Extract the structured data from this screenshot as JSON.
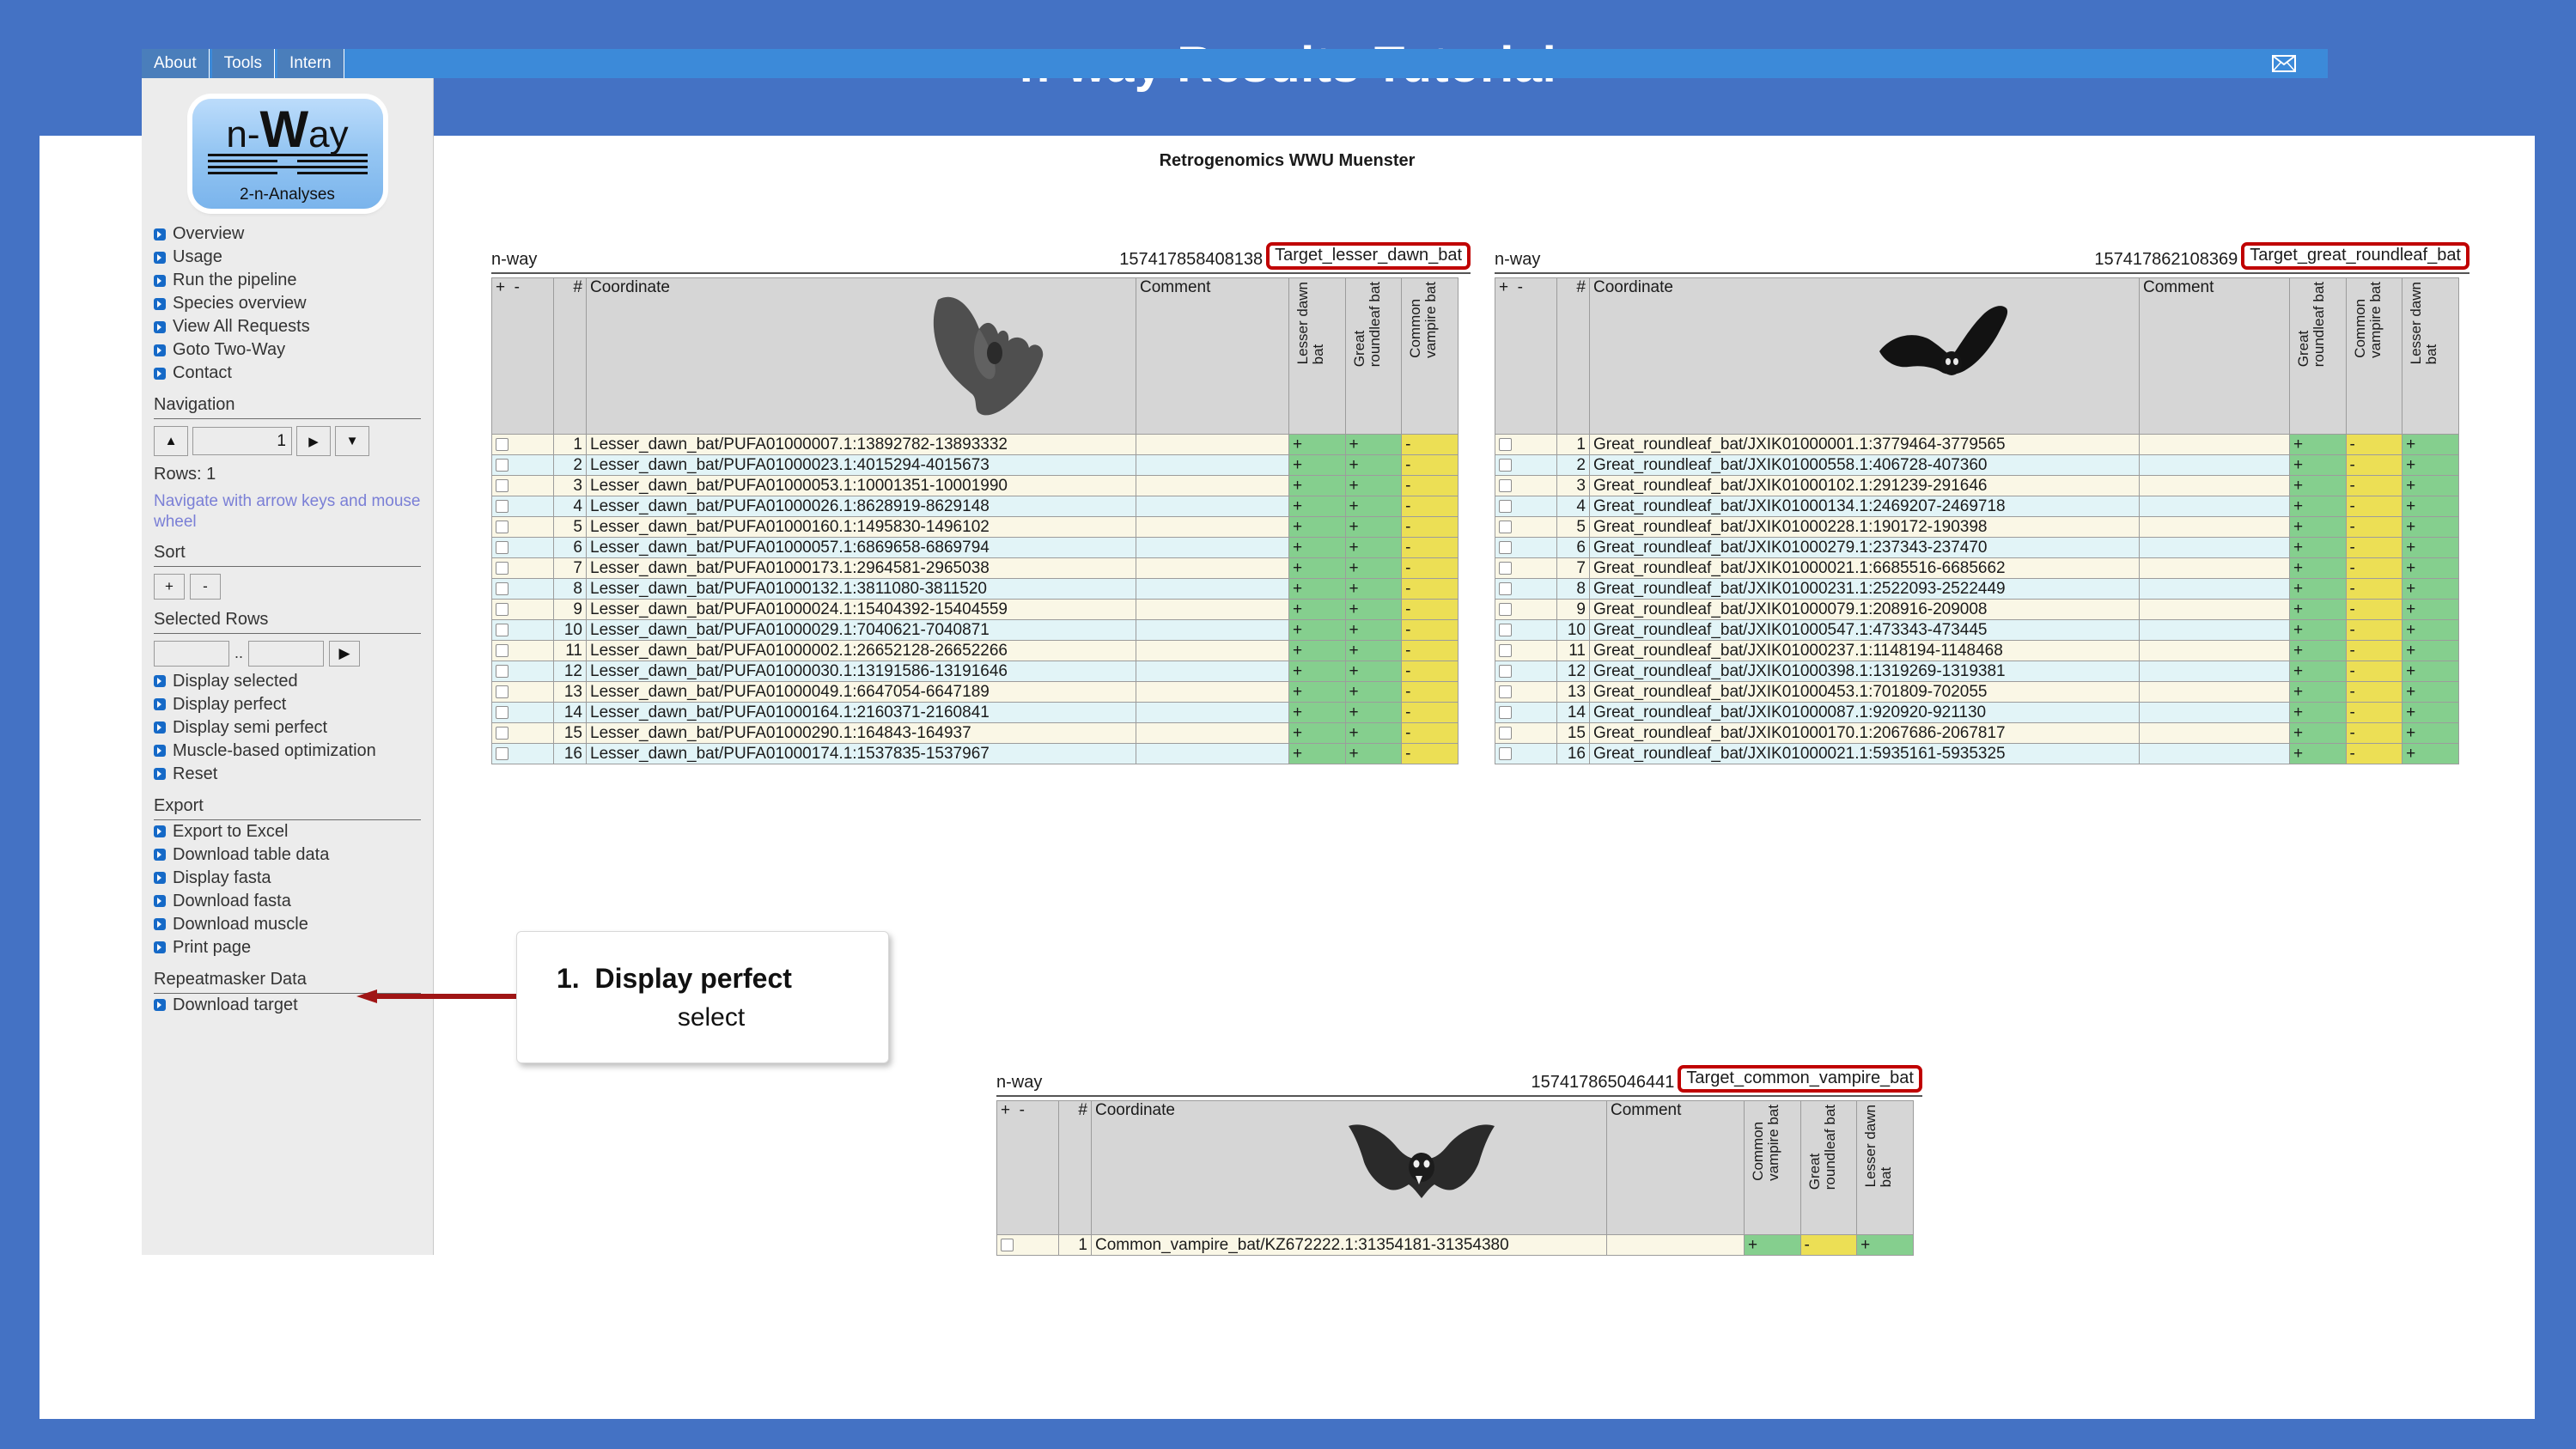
{
  "slide": {
    "title": "n-way Results Tutorial",
    "accent_color": "#4472c4"
  },
  "page_header": "Retrogenomics WWU Muenster",
  "navbar": {
    "items": [
      "About",
      "Tools",
      "Intern"
    ],
    "mail_icon": "envelope-icon"
  },
  "sidebar": {
    "logo": {
      "line1_prefix": "n-",
      "line1_big": "W",
      "line1_suffix": "ay",
      "caption": "2-n-Analyses"
    },
    "main_links": [
      "Overview",
      "Usage",
      "Run the pipeline",
      "Species overview",
      "View All Requests",
      "Goto Two-Way",
      "Contact"
    ],
    "navigation": {
      "heading": "Navigation",
      "up_label": "▲",
      "page_value": "1",
      "go_label": "▶",
      "down_label": "▼",
      "rows_label": "Rows: 1",
      "hint": "Navigate with arrow keys and mouse wheel"
    },
    "sort": {
      "heading": "Sort",
      "plus_label": "+",
      "minus_label": "-"
    },
    "selected_rows": {
      "heading": "Selected Rows",
      "from_value": "",
      "separator": "..",
      "to_value": "",
      "go_label": "▶",
      "links": [
        "Display selected",
        "Display perfect",
        "Display semi perfect",
        "Muscle-based optimization",
        "Reset"
      ]
    },
    "export": {
      "heading": "Export",
      "links": [
        "Export to Excel",
        "Download table data",
        "Display fasta",
        "Download fasta",
        "Download muscle",
        "Print page"
      ]
    },
    "repeatmasker": {
      "heading": "Repeatmasker Data",
      "links": [
        "Download target"
      ]
    }
  },
  "callout": {
    "step": "1.",
    "title": "Display perfect",
    "subtitle": "select",
    "arrow_color": "#a01515"
  },
  "tables": [
    {
      "caption_left": "n-way",
      "id": "157417858408138",
      "target": "Target_lesser_dawn_bat",
      "bat_icon": "fruit-bat-silhouette",
      "columns": {
        "plus": "+",
        "minus": "-",
        "hash": "#",
        "coordinate": "Coordinate",
        "comment": "Comment",
        "species": [
          "Lesser dawn\nbat",
          "Great\nroundleaf bat",
          "Common\nvampire bat"
        ]
      },
      "rows": [
        {
          "n": "1",
          "coord": "Lesser_dawn_bat/PUFA01000007.1:13892782-13893332",
          "comment": "",
          "marks": [
            "+",
            "+",
            "-"
          ]
        },
        {
          "n": "2",
          "coord": "Lesser_dawn_bat/PUFA01000023.1:4015294-4015673",
          "comment": "",
          "marks": [
            "+",
            "+",
            "-"
          ]
        },
        {
          "n": "3",
          "coord": "Lesser_dawn_bat/PUFA01000053.1:10001351-10001990",
          "comment": "",
          "marks": [
            "+",
            "+",
            "-"
          ]
        },
        {
          "n": "4",
          "coord": "Lesser_dawn_bat/PUFA01000026.1:8628919-8629148",
          "comment": "",
          "marks": [
            "+",
            "+",
            "-"
          ]
        },
        {
          "n": "5",
          "coord": "Lesser_dawn_bat/PUFA01000160.1:1495830-1496102",
          "comment": "",
          "marks": [
            "+",
            "+",
            "-"
          ]
        },
        {
          "n": "6",
          "coord": "Lesser_dawn_bat/PUFA01000057.1:6869658-6869794",
          "comment": "",
          "marks": [
            "+",
            "+",
            "-"
          ]
        },
        {
          "n": "7",
          "coord": "Lesser_dawn_bat/PUFA01000173.1:2964581-2965038",
          "comment": "",
          "marks": [
            "+",
            "+",
            "-"
          ]
        },
        {
          "n": "8",
          "coord": "Lesser_dawn_bat/PUFA01000132.1:3811080-3811520",
          "comment": "",
          "marks": [
            "+",
            "+",
            "-"
          ]
        },
        {
          "n": "9",
          "coord": "Lesser_dawn_bat/PUFA01000024.1:15404392-15404559",
          "comment": "",
          "marks": [
            "+",
            "+",
            "-"
          ]
        },
        {
          "n": "10",
          "coord": "Lesser_dawn_bat/PUFA01000029.1:7040621-7040871",
          "comment": "",
          "marks": [
            "+",
            "+",
            "-"
          ]
        },
        {
          "n": "11",
          "coord": "Lesser_dawn_bat/PUFA01000002.1:26652128-26652266",
          "comment": "",
          "marks": [
            "+",
            "+",
            "-"
          ]
        },
        {
          "n": "12",
          "coord": "Lesser_dawn_bat/PUFA01000030.1:13191586-13191646",
          "comment": "",
          "marks": [
            "+",
            "+",
            "-"
          ]
        },
        {
          "n": "13",
          "coord": "Lesser_dawn_bat/PUFA01000049.1:6647054-6647189",
          "comment": "",
          "marks": [
            "+",
            "+",
            "-"
          ]
        },
        {
          "n": "14",
          "coord": "Lesser_dawn_bat/PUFA01000164.1:2160371-2160841",
          "comment": "",
          "marks": [
            "+",
            "+",
            "-"
          ]
        },
        {
          "n": "15",
          "coord": "Lesser_dawn_bat/PUFA01000290.1:164843-164937",
          "comment": "",
          "marks": [
            "+",
            "+",
            "-"
          ]
        },
        {
          "n": "16",
          "coord": "Lesser_dawn_bat/PUFA01000174.1:1537835-1537967",
          "comment": "",
          "marks": [
            "+",
            "+",
            "-"
          ]
        }
      ]
    },
    {
      "caption_left": "n-way",
      "id": "157417862108369",
      "target": "Target_great_roundleaf_bat",
      "bat_icon": "roundleaf-bat-silhouette",
      "columns": {
        "plus": "+",
        "minus": "-",
        "hash": "#",
        "coordinate": "Coordinate",
        "comment": "Comment",
        "species": [
          "Great\nroundleaf bat",
          "Common\nvampire bat",
          "Lesser dawn\nbat"
        ]
      },
      "rows": [
        {
          "n": "1",
          "coord": "Great_roundleaf_bat/JXIK01000001.1:3779464-3779565",
          "comment": "",
          "marks": [
            "+",
            "-",
            "+"
          ]
        },
        {
          "n": "2",
          "coord": "Great_roundleaf_bat/JXIK01000558.1:406728-407360",
          "comment": "",
          "marks": [
            "+",
            "-",
            "+"
          ]
        },
        {
          "n": "3",
          "coord": "Great_roundleaf_bat/JXIK01000102.1:291239-291646",
          "comment": "",
          "marks": [
            "+",
            "-",
            "+"
          ]
        },
        {
          "n": "4",
          "coord": "Great_roundleaf_bat/JXIK01000134.1:2469207-2469718",
          "comment": "",
          "marks": [
            "+",
            "-",
            "+"
          ]
        },
        {
          "n": "5",
          "coord": "Great_roundleaf_bat/JXIK01000228.1:190172-190398",
          "comment": "",
          "marks": [
            "+",
            "-",
            "+"
          ]
        },
        {
          "n": "6",
          "coord": "Great_roundleaf_bat/JXIK01000279.1:237343-237470",
          "comment": "",
          "marks": [
            "+",
            "-",
            "+"
          ]
        },
        {
          "n": "7",
          "coord": "Great_roundleaf_bat/JXIK01000021.1:6685516-6685662",
          "comment": "",
          "marks": [
            "+",
            "-",
            "+"
          ]
        },
        {
          "n": "8",
          "coord": "Great_roundleaf_bat/JXIK01000231.1:2522093-2522449",
          "comment": "",
          "marks": [
            "+",
            "-",
            "+"
          ]
        },
        {
          "n": "9",
          "coord": "Great_roundleaf_bat/JXIK01000079.1:208916-209008",
          "comment": "",
          "marks": [
            "+",
            "-",
            "+"
          ]
        },
        {
          "n": "10",
          "coord": "Great_roundleaf_bat/JXIK01000547.1:473343-473445",
          "comment": "",
          "marks": [
            "+",
            "-",
            "+"
          ]
        },
        {
          "n": "11",
          "coord": "Great_roundleaf_bat/JXIK01000237.1:1148194-1148468",
          "comment": "",
          "marks": [
            "+",
            "-",
            "+"
          ]
        },
        {
          "n": "12",
          "coord": "Great_roundleaf_bat/JXIK01000398.1:1319269-1319381",
          "comment": "",
          "marks": [
            "+",
            "-",
            "+"
          ]
        },
        {
          "n": "13",
          "coord": "Great_roundleaf_bat/JXIK01000453.1:701809-702055",
          "comment": "",
          "marks": [
            "+",
            "-",
            "+"
          ]
        },
        {
          "n": "14",
          "coord": "Great_roundleaf_bat/JXIK01000087.1:920920-921130",
          "comment": "",
          "marks": [
            "+",
            "-",
            "+"
          ]
        },
        {
          "n": "15",
          "coord": "Great_roundleaf_bat/JXIK01000170.1:2067686-2067817",
          "comment": "",
          "marks": [
            "+",
            "-",
            "+"
          ]
        },
        {
          "n": "16",
          "coord": "Great_roundleaf_bat/JXIK01000021.1:5935161-5935325",
          "comment": "",
          "marks": [
            "+",
            "-",
            "+"
          ]
        }
      ]
    },
    {
      "caption_left": "n-way",
      "id": "157417865046441",
      "target": "Target_common_vampire_bat",
      "bat_icon": "vampire-bat-silhouette",
      "columns": {
        "plus": "+",
        "minus": "-",
        "hash": "#",
        "coordinate": "Coordinate",
        "comment": "Comment",
        "species": [
          "Common\nvampire bat",
          "Great\nroundleaf bat",
          "Lesser dawn\nbat"
        ]
      },
      "rows": [
        {
          "n": "1",
          "coord": "Common_vampire_bat/KZ672222.1:31354181-31354380",
          "comment": "",
          "marks": [
            "+",
            "-",
            "+"
          ]
        }
      ]
    }
  ],
  "colors": {
    "plus_cell": "#85cf8e",
    "minus_cell": "#ecdf55",
    "row_odd": "#faf7e6",
    "row_even": "#e2f4f7",
    "header_cell": "#d6d6d6",
    "target_box_border": "#c00000",
    "nav_blue": "#4a7ebb"
  }
}
